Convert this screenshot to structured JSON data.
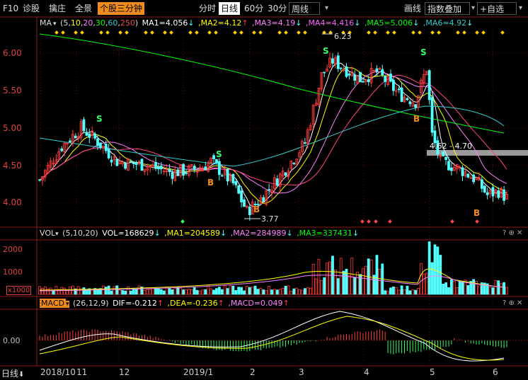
{
  "toolbar": {
    "left": [
      "F10",
      "诊股",
      "擒庄",
      "全景"
    ],
    "highlight": "个股三分钟",
    "periods": [
      "分时",
      "日线",
      "60分",
      "30分"
    ],
    "active_period": "日线",
    "weekly": "周线",
    "right": [
      "画线",
      "指数叠加",
      "自选"
    ]
  },
  "ma_header": {
    "name": "MA",
    "params_prefix": "(5,",
    "params": [
      "10",
      "20",
      "30",
      "60",
      "250"
    ],
    "params_suffix": ")",
    "items": [
      {
        "label": "MA1=4.056",
        "arrow": "↓"
      },
      {
        "label": ",MA2=4.12",
        "arrow": "↑"
      },
      {
        "label": ",MA3=4.19",
        "arrow": "↓"
      },
      {
        "label": ",MA4=4.416",
        "arrow": "↓"
      },
      {
        "label": ",MA5=5.006",
        "arrow": "↓"
      },
      {
        "label": ",MA6=4.92",
        "arrow": "↓"
      }
    ]
  },
  "vol_header": {
    "name": "VOL",
    "params": "(5,10,20)",
    "items": [
      {
        "label": "VOL=168629",
        "arrow": "↓"
      },
      {
        "label": ",MA1=204589",
        "arrow": "↓"
      },
      {
        "label": ",MA2=284989",
        "arrow": "↓"
      },
      {
        "label": ",MA3=337431",
        "arrow": "↓"
      }
    ]
  },
  "macd_header": {
    "name": "MACD",
    "params": "(26,12,9)",
    "items": [
      {
        "label": "DIF=-0.212",
        "arrow": "↑"
      },
      {
        "label": ",DEA=-0.236",
        "arrow": "↑"
      },
      {
        "label": ",MACD=0.049",
        "arrow": "↑"
      }
    ]
  },
  "price_axis": [
    "6.00",
    "5.50",
    "5.00",
    "4.50",
    "4.00"
  ],
  "vol_axis": [
    "2000",
    "1000"
  ],
  "vol_unit": "x1000",
  "macd_axis": "0.00",
  "x_axis": {
    "period": "日线",
    "labels": [
      "2018/10",
      "11",
      "12",
      "2019/1",
      "2",
      "3",
      "4",
      "5",
      "6"
    ]
  },
  "annotations": {
    "high": "6.23",
    "low": "3.77",
    "range_label": "4.62 - 4.70",
    "buy": "B",
    "sell": "S"
  },
  "panel_buttons": "? ⊕ ✕",
  "colors": {
    "up": "#ff3c3c",
    "down": "#54ffff",
    "ma1": "#ffffff",
    "ma2": "#ffff00",
    "ma3": "#ff80ff",
    "ma4": "#00ff00",
    "ma5": "#33cccc",
    "ma6": "#e05050",
    "accent": "#f08c1e"
  }
}
